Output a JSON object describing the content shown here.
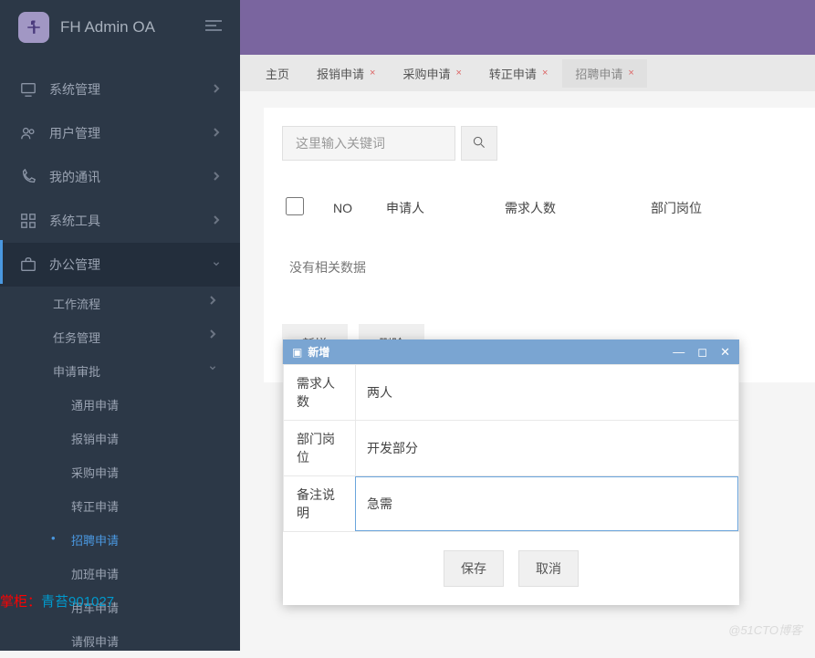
{
  "brand": {
    "title": "FH Admin OA"
  },
  "sidebar": {
    "items": [
      {
        "label": "系统管理"
      },
      {
        "label": "用户管理"
      },
      {
        "label": "我的通讯"
      },
      {
        "label": "系统工具"
      },
      {
        "label": "办公管理"
      }
    ],
    "submenu": [
      {
        "label": "工作流程"
      },
      {
        "label": "任务管理"
      },
      {
        "label": "申请审批"
      }
    ],
    "deep": [
      {
        "label": "通用申请"
      },
      {
        "label": "报销申请"
      },
      {
        "label": "采购申请"
      },
      {
        "label": "转正申请"
      },
      {
        "label": "招聘申请",
        "active": true
      },
      {
        "label": "加班申请"
      },
      {
        "label": "用车申请"
      },
      {
        "label": "请假申请"
      }
    ]
  },
  "tabs": [
    {
      "label": "主页",
      "closable": false
    },
    {
      "label": "报销申请",
      "closable": true
    },
    {
      "label": "采购申请",
      "closable": true
    },
    {
      "label": "转正申请",
      "closable": true
    },
    {
      "label": "招聘申请",
      "closable": true,
      "active": true
    }
  ],
  "search": {
    "placeholder": "这里输入关键词"
  },
  "table": {
    "cols": {
      "no": "NO",
      "applicant": "申请人",
      "demand": "需求人数",
      "dept": "部门岗位"
    },
    "empty": "没有相关数据"
  },
  "actions": {
    "add": "新增",
    "delete": "删除"
  },
  "dialog": {
    "title": "新增",
    "rows": {
      "demand": {
        "label": "需求人数",
        "value": "两人"
      },
      "dept": {
        "label": "部门岗位",
        "value": "开发部分"
      },
      "remark": {
        "label": "备注说明",
        "value": "急需"
      }
    },
    "save": "保存",
    "cancel": "取消"
  },
  "watermark": "@51CTO博客",
  "overlay": {
    "prefix": "掌柜：",
    "name": "青苔901027"
  }
}
